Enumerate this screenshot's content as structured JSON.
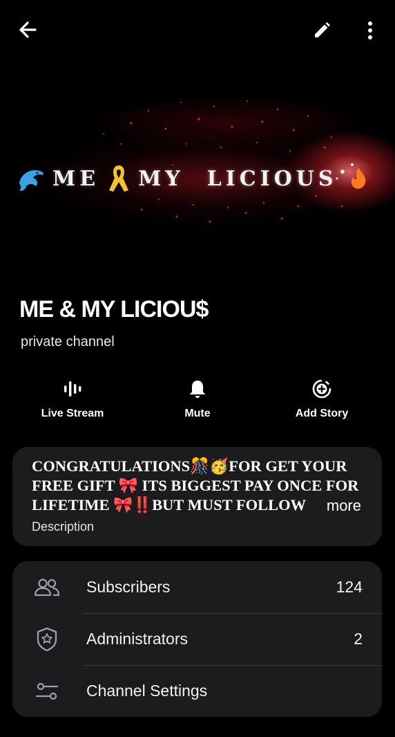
{
  "topbar": {
    "back_icon": "arrow-left-icon",
    "edit_icon": "pencil-icon",
    "more_icon": "more-vertical-icon"
  },
  "cover": {
    "banner_text": "ME & MY LICIOUS",
    "accent_color": "#c4141e"
  },
  "channel": {
    "title": "ME & MY LICIOU$",
    "subtitle": "private channel"
  },
  "actions": [
    {
      "label": "Live Stream",
      "icon": "live-stream-icon"
    },
    {
      "label": "Mute",
      "icon": "bell-icon"
    },
    {
      "label": "Add Story",
      "icon": "add-story-icon"
    }
  ],
  "description": {
    "text": "CONGRATULATIONS🎊🥳FOR GET YOUR FREE GIFT 🎀 ITS BIGGEST PAY ONCE FOR LIFETIME 🎀‼️BUT MUST FOLLOW",
    "more_label": "more",
    "label": "Description"
  },
  "info": {
    "rows": [
      {
        "label": "Subscribers",
        "value": "124",
        "icon": "users-icon"
      },
      {
        "label": "Administrators",
        "value": "2",
        "icon": "shield-star-icon"
      },
      {
        "label": "Channel Settings",
        "value": "",
        "icon": "sliders-icon"
      }
    ]
  },
  "colors": {
    "background": "#000000",
    "card": "#1c1c1e",
    "divider": "#3a3a3c",
    "text": "#ffffff"
  }
}
